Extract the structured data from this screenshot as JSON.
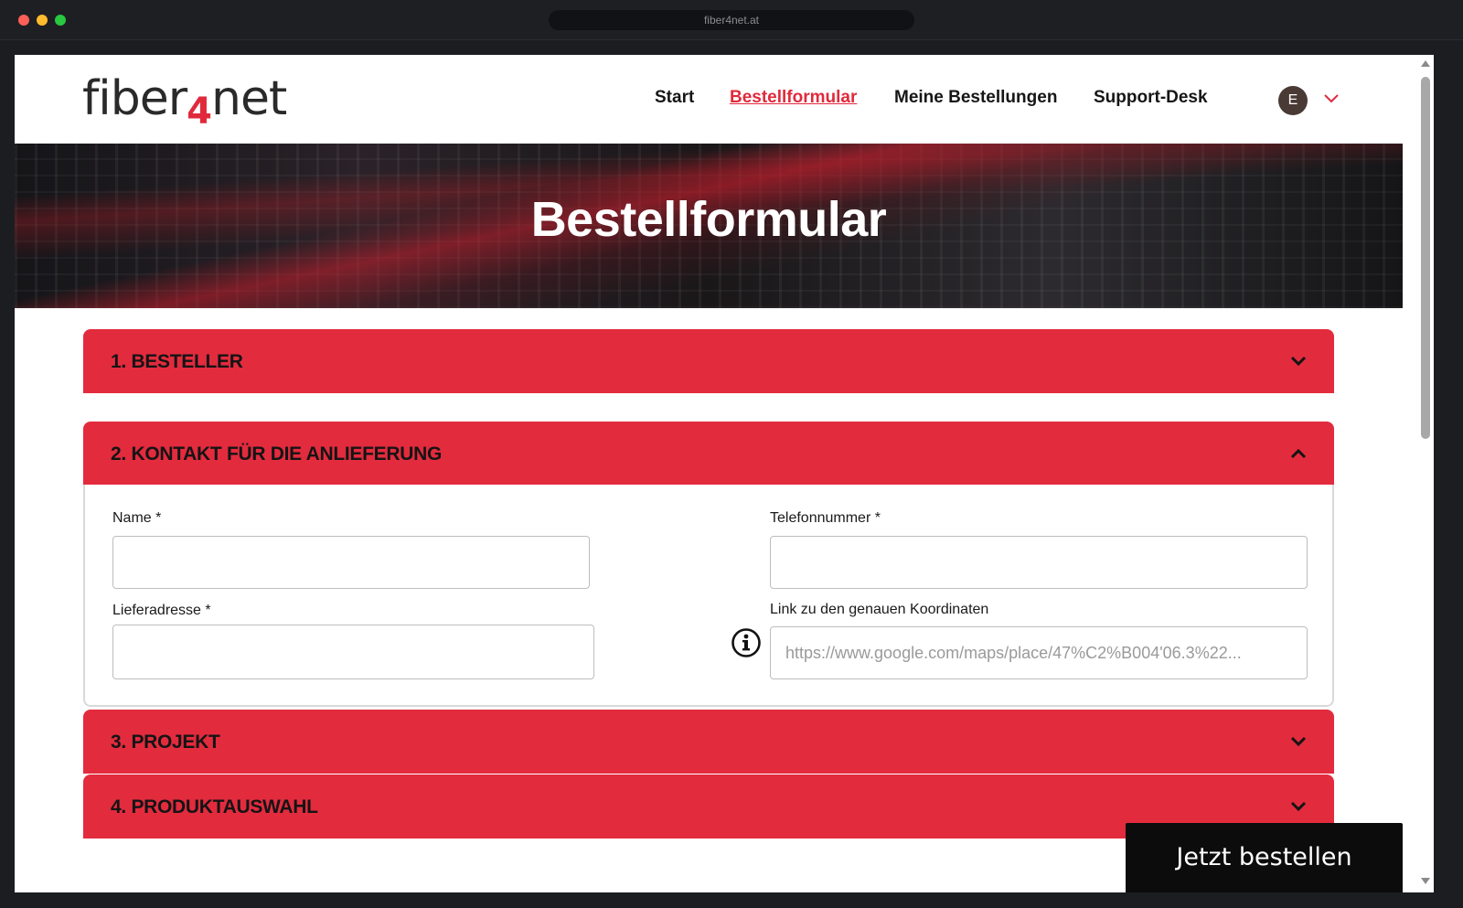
{
  "browser": {
    "url": "fiber4net.at"
  },
  "header": {
    "logo_part1": "fiber",
    "logo_digit": "4",
    "logo_part2": "net",
    "nav": {
      "start": "Start",
      "order_form": "Bestellformular",
      "my_orders": "Meine Bestellungen",
      "support": "Support-Desk"
    },
    "avatar_initial": "E"
  },
  "hero": {
    "title": "Bestellformular"
  },
  "sections": {
    "s1": {
      "title": "1. BESTELLER",
      "state": "collapsed"
    },
    "s2": {
      "title": "2. KONTAKT FÜR DIE ANLIEFERUNG",
      "state": "expanded"
    },
    "s3": {
      "title": "3. PROJEKT",
      "state": "collapsed"
    },
    "s4": {
      "title": "4. PRODUKTAUSWAHL",
      "state": "collapsed"
    }
  },
  "contact_form": {
    "name_label": "Name *",
    "name_value": "",
    "phone_label": "Telefonnummer *",
    "phone_value": "",
    "address_label": "Lieferadresse *",
    "address_value": "",
    "coords_label": "Link zu den genauen Koordinaten",
    "coords_placeholder": "https://www.google.com/maps/place/47%C2%B004'06.3%22..."
  },
  "actions": {
    "order_button": "Jetzt bestellen"
  },
  "colors": {
    "accent": "#e32b3e",
    "text": "#161616",
    "button_bg": "#0c0c0c"
  }
}
